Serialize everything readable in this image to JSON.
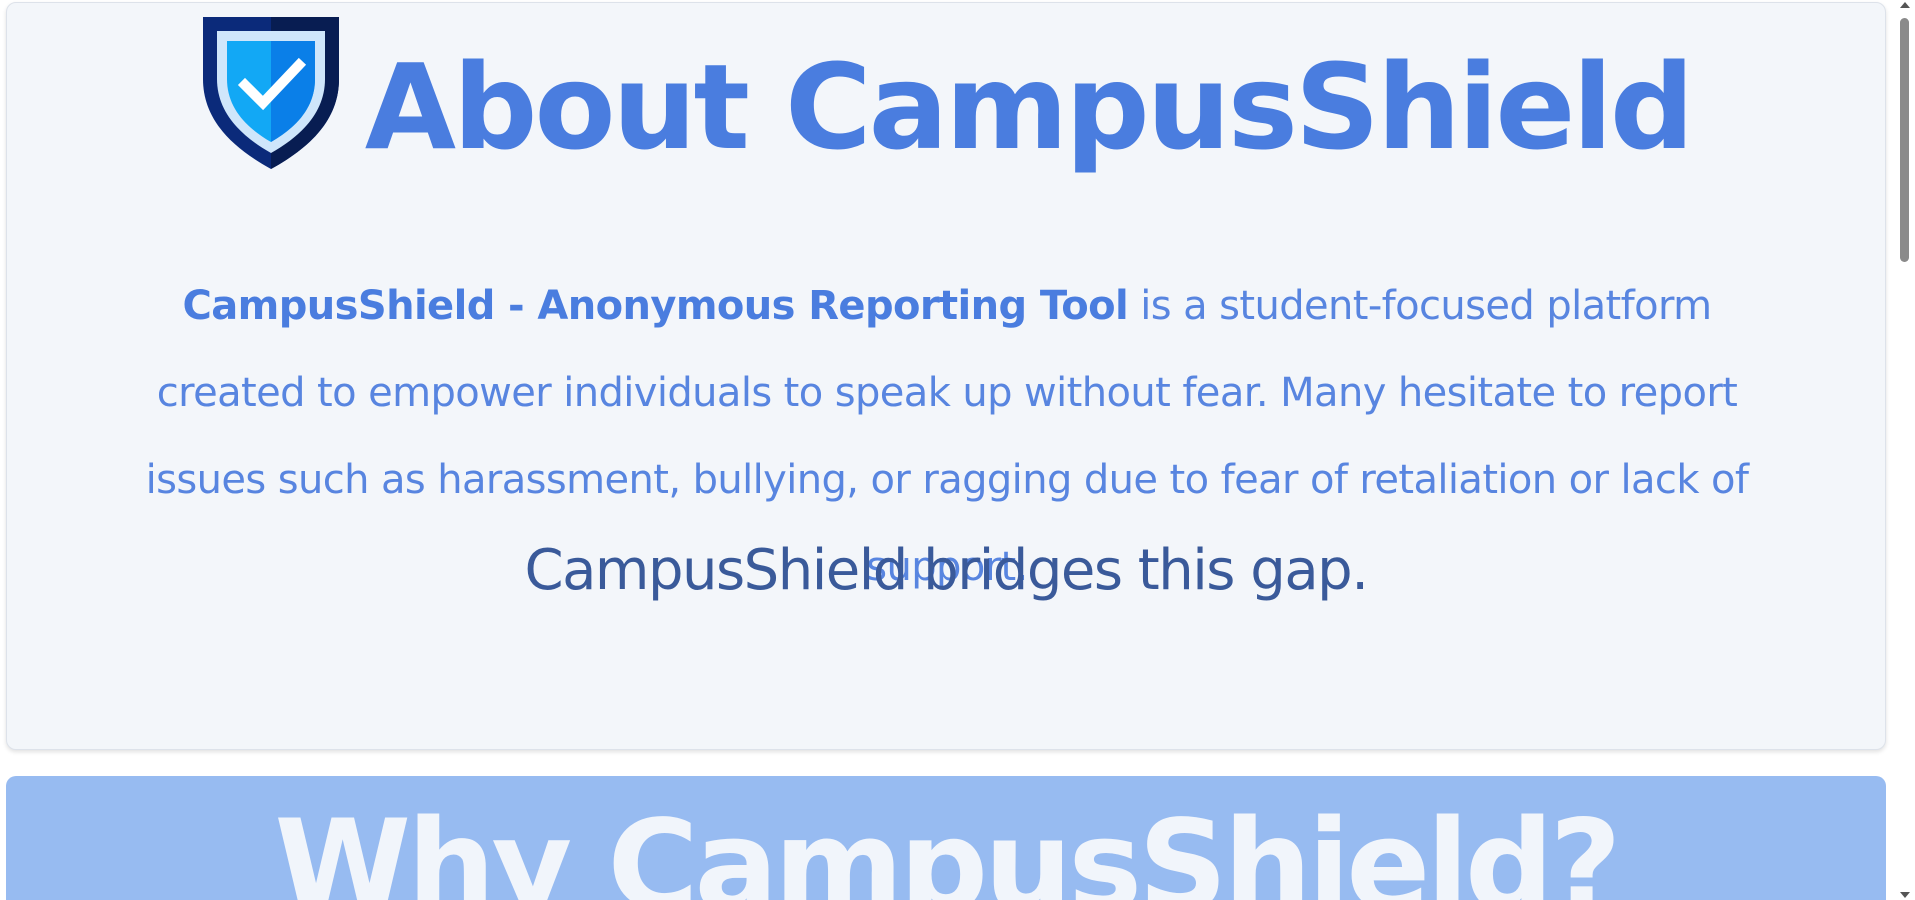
{
  "about": {
    "title": "About CampusShield",
    "desc_strong": "CampusShield - Anonymous Reporting Tool",
    "desc_rest": " is a student-focused platform created to empower individuals to speak up without fear. Many hesitate to report issues such as harassment, bullying, or ragging due to fear of retaliation or lack of support.",
    "tagline": "CampusShield bridges this gap.",
    "logo_icon": "shield-check-icon"
  },
  "why": {
    "title": "Why CampusShield?"
  },
  "colors": {
    "accent": "#4a7ddf",
    "text": "#5885e0",
    "tagline": "#3a5a9a",
    "card_bg": "#f3f6fa",
    "why_bg": "#97bbf1"
  }
}
